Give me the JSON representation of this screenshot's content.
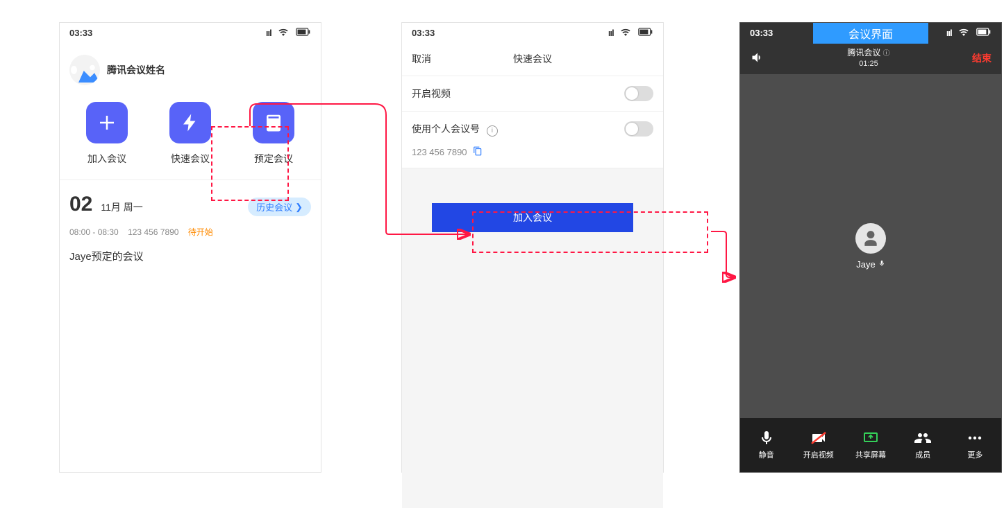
{
  "statusbar": {
    "time": "03:33"
  },
  "screen1": {
    "username": "腾讯会议姓名",
    "action_join": "加入会议",
    "action_quick": "快速会议",
    "action_schedule": "预定会议",
    "date_day": "02",
    "date_rest": "11月 周一",
    "history": "历史会议",
    "meeting_time": "08:00 - 08:30",
    "meeting_id": "123 456 7890",
    "meeting_status": "待开始",
    "meeting_title": "Jaye预定的会议"
  },
  "screen2": {
    "cancel": "取消",
    "title": "快速会议",
    "row_video": "开启视频",
    "row_personal": "使用个人会议号",
    "meeting_number": "123 456 7890",
    "join_btn": "加入会议"
  },
  "screen3": {
    "interface_label": "会议界面",
    "title": "腾讯会议",
    "timer": "01:25",
    "end": "结束",
    "participant": "Jaye",
    "foot_mute": "静音",
    "foot_video": "开启视频",
    "foot_share": "共享屏幕",
    "foot_members": "成员",
    "foot_more": "更多"
  }
}
